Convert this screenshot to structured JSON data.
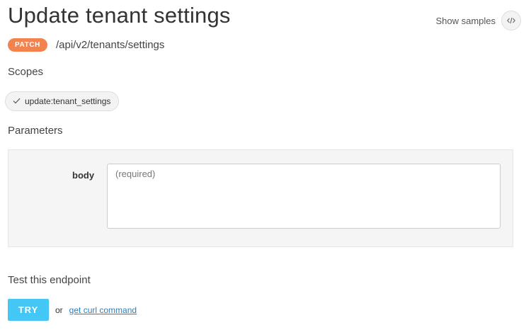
{
  "page": {
    "title": "Update tenant settings",
    "show_samples_label": "Show samples",
    "show_samples_icon": "code-icon"
  },
  "endpoint": {
    "method": "PATCH",
    "method_color": "#f2834f",
    "path": "/api/v2/tenants/settings"
  },
  "scopes": {
    "heading": "Scopes",
    "items": [
      {
        "label": "update:tenant_settings",
        "icon": "checkmark-icon"
      }
    ]
  },
  "parameters": {
    "heading": "Parameters",
    "fields": [
      {
        "label": "body",
        "value": "",
        "placeholder": "(required)"
      }
    ]
  },
  "test": {
    "heading": "Test this endpoint",
    "try_label": "TRY",
    "try_color": "#44c7f4",
    "or_text": "or",
    "curl_link": "get curl command"
  }
}
